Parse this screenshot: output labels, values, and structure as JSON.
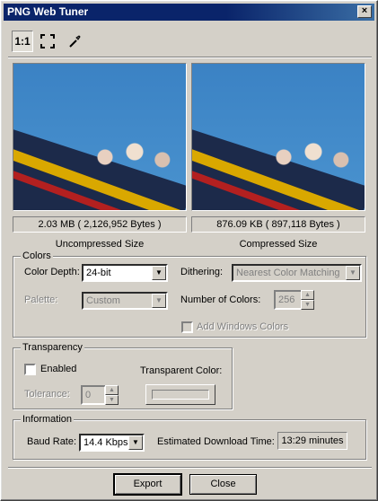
{
  "window": {
    "title": "PNG Web Tuner",
    "close_glyph": "×"
  },
  "toolbar": {
    "actual_size_label": "1:1",
    "fit_icon": "fit-to-window-icon",
    "eyedropper_icon": "eyedropper-icon"
  },
  "previews": {
    "uncompressed": {
      "size_text": "2.03 MB ( 2,126,952 Bytes )",
      "caption": "Uncompressed Size"
    },
    "compressed": {
      "size_text": "876.09 KB ( 897,118 Bytes )",
      "caption": "Compressed Size"
    }
  },
  "colors": {
    "legend": "Colors",
    "color_depth_label": "Color Depth:",
    "color_depth_value": "24-bit",
    "dithering_label": "Dithering:",
    "dithering_value": "Nearest Color Matching",
    "palette_label": "Palette:",
    "palette_value": "Custom",
    "num_colors_label": "Number of Colors:",
    "num_colors_value": "256",
    "add_windows_colors_label": "Add Windows Colors"
  },
  "transparency": {
    "legend": "Transparency",
    "enabled_label": "Enabled",
    "transparent_color_label": "Transparent Color:",
    "tolerance_label": "Tolerance:",
    "tolerance_value": "0"
  },
  "information": {
    "legend": "Information",
    "baud_rate_label": "Baud Rate:",
    "baud_rate_value": "14.4 Kbps",
    "download_time_label": "Estimated Download Time:",
    "download_time_value": "13:29 minutes"
  },
  "buttons": {
    "export": "Export",
    "close": "Close"
  }
}
